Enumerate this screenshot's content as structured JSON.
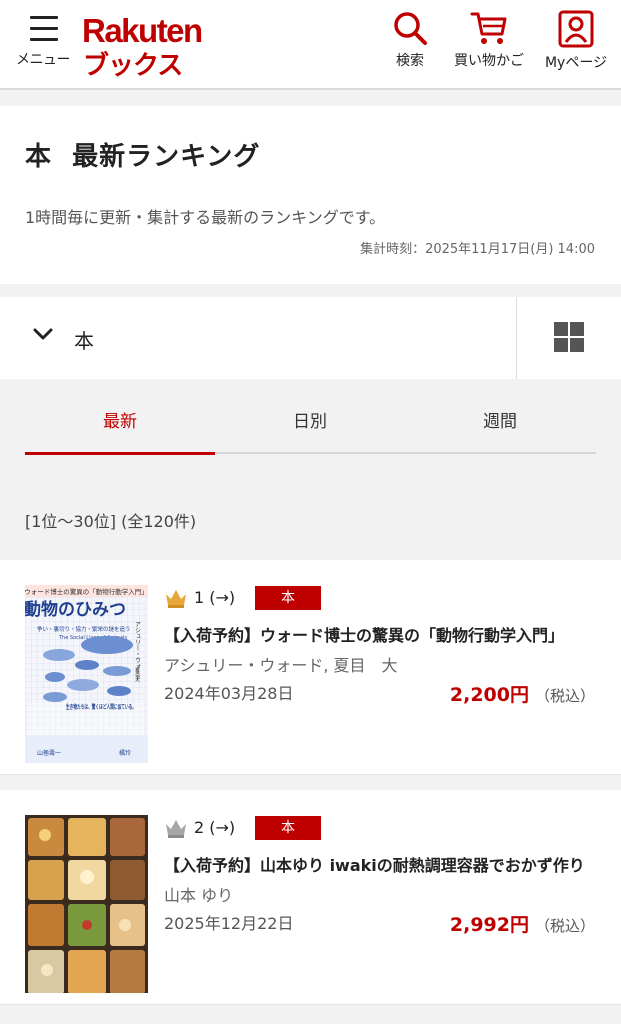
{
  "header": {
    "menu_label": "メニュー",
    "logo_top": "Rakuten",
    "logo_bottom": "ブックス",
    "search_label": "検索",
    "cart_label": "買い物かご",
    "mypage_label": "Myページ",
    "brand_color": "#bf0000"
  },
  "ranking": {
    "title": "本  最新ランキング",
    "description": "1時間毎に更新・集計する最新のランキングです。",
    "timestamp": "集計時刻：2025年11月17日(月) 14:00"
  },
  "category": {
    "selected": "本",
    "toggle_icon": "chevron-down-icon",
    "view_icon": "grid-view-icon"
  },
  "tabs": [
    {
      "label": "最新",
      "active": true
    },
    {
      "label": "日別",
      "active": false
    },
    {
      "label": "週間",
      "active": false
    }
  ],
  "range_text": "[1位〜30位] (全120件)",
  "items": [
    {
      "rank": "1 (→)",
      "crown": "gold-crown-icon",
      "badge": "本",
      "title": "【入荷予約】ウォード博士の驚異の「動物行動学入門」",
      "author": "アシュリー・ウォード, 夏目　大",
      "date": "2024年03月28日",
      "price": "2,200円",
      "tax": "（税込）",
      "cover": {
        "top": "ウォード博士の驚異の「動物行動学入門」",
        "title": "動物のひみつ",
        "subtitle": "The Social Lives of Animals",
        "author": "アシュリー・ウォード",
        "blurb": "生き物たちは、驚くほど人間に似ている。",
        "side": "争い・裏切り・協力・繁栄の謎を追う",
        "translator": "夏目大",
        "recommender_left": "山極壽一",
        "recommender_right": "橘玲"
      }
    },
    {
      "rank": "2 (→)",
      "crown": "silver-crown-icon",
      "badge": "本",
      "title": "【入荷予約】山本ゆり iwakiの耐熱調理容器でおかず作り",
      "author": "山本 ゆり",
      "date": "2025年12月22日",
      "price": "2,992円",
      "tax": "（税込）"
    }
  ]
}
